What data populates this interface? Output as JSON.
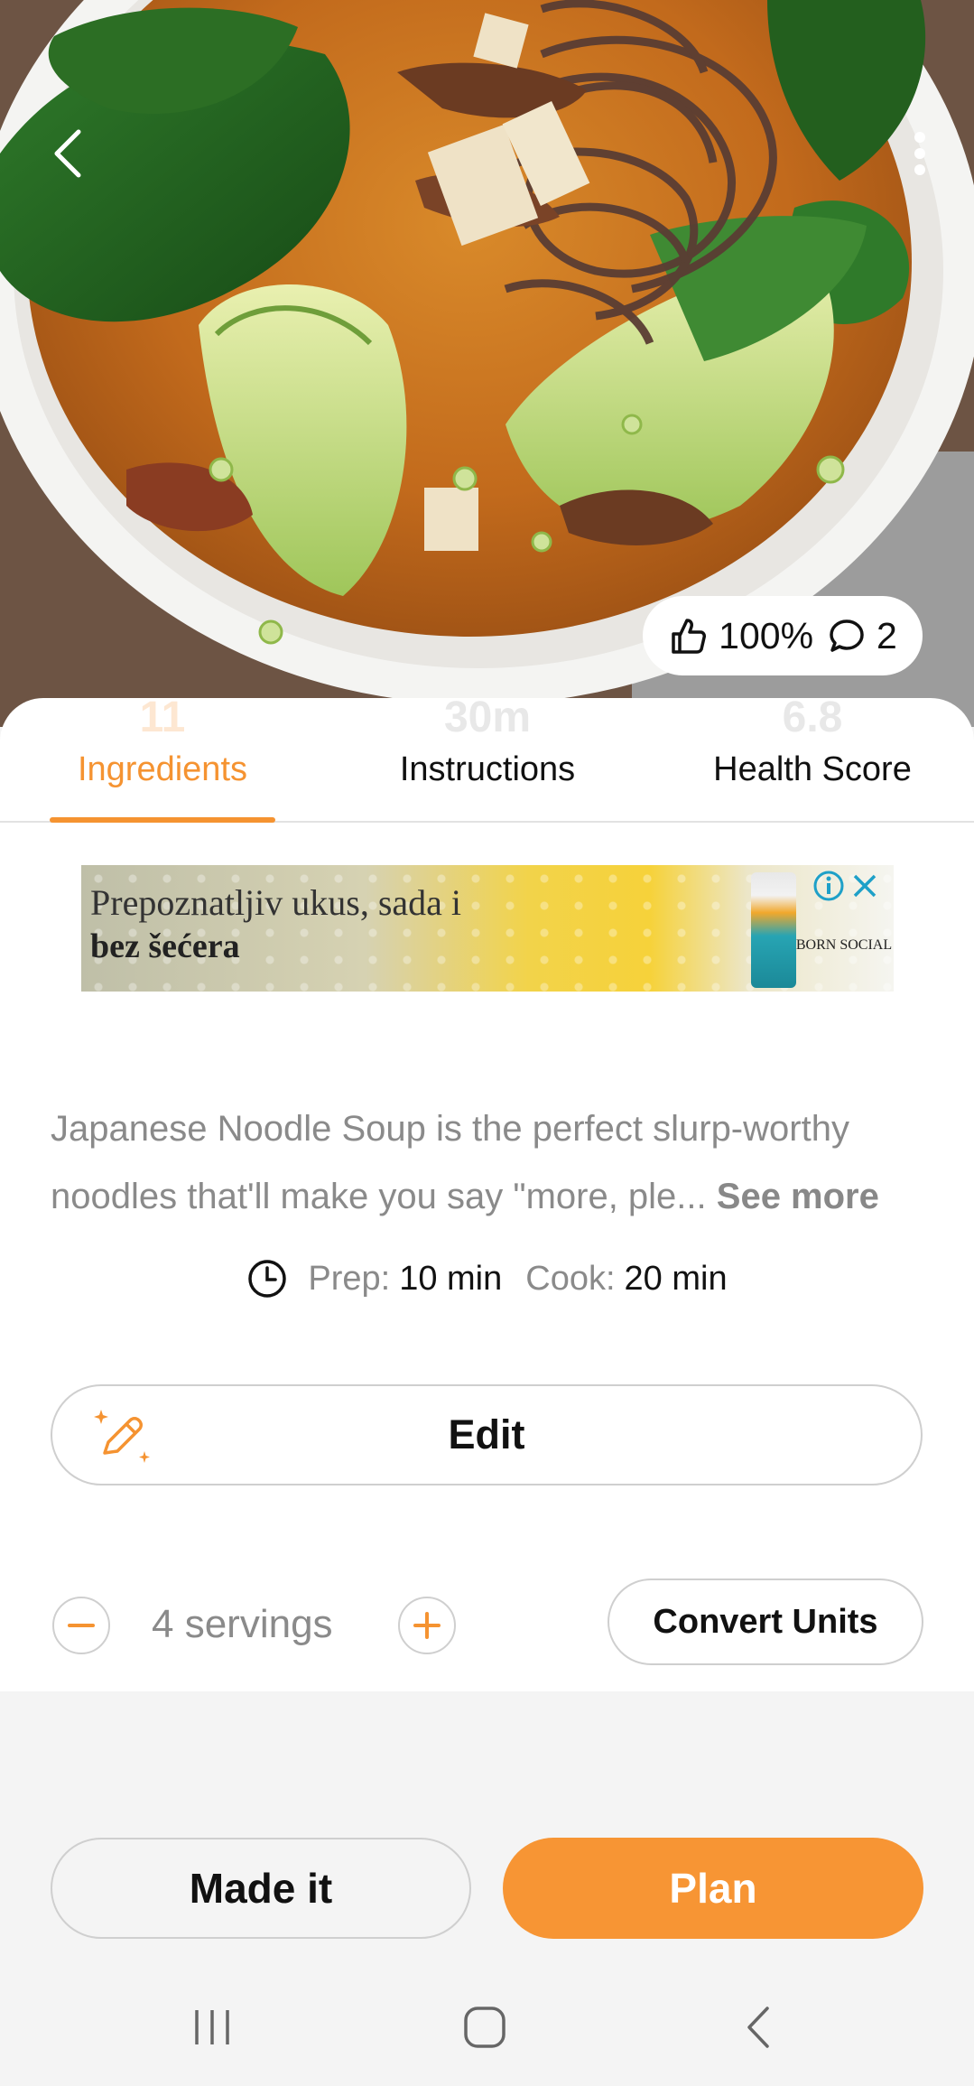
{
  "hero": {
    "likes_pct": "100%",
    "comments": "2",
    "icons": {
      "back": "chevron-left-icon",
      "more": "more-vertical-icon",
      "like": "thumbs-up-icon",
      "comment": "comment-icon"
    }
  },
  "tabs": [
    {
      "value": "11",
      "label": "Ingredients",
      "active": true
    },
    {
      "value": "30m",
      "label": "Instructions",
      "active": false
    },
    {
      "value": "6.8",
      "label": "Health Score",
      "active": false
    }
  ],
  "ad": {
    "line1": "Prepoznatljiv ukus, sada i",
    "line2": "bez šećera",
    "brand": "BORN SOCIAL"
  },
  "description": {
    "text": "Japanese Noodle Soup is the perfect slurp-worthy noodles that'll make you say \"more, ple...",
    "see_more": "See more"
  },
  "times": {
    "prep_label": "Prep:",
    "prep_value": "10 min",
    "cook_label": "Cook:",
    "cook_value": "20 min"
  },
  "edit_label": "Edit",
  "servings": {
    "text": "4 servings"
  },
  "convert_units_label": "Convert Units",
  "actions": {
    "made_it": "Made it",
    "plan": "Plan"
  },
  "colors": {
    "accent": "#f79534",
    "muted_text": "#8a8a8a",
    "border": "#cfcfcf"
  }
}
